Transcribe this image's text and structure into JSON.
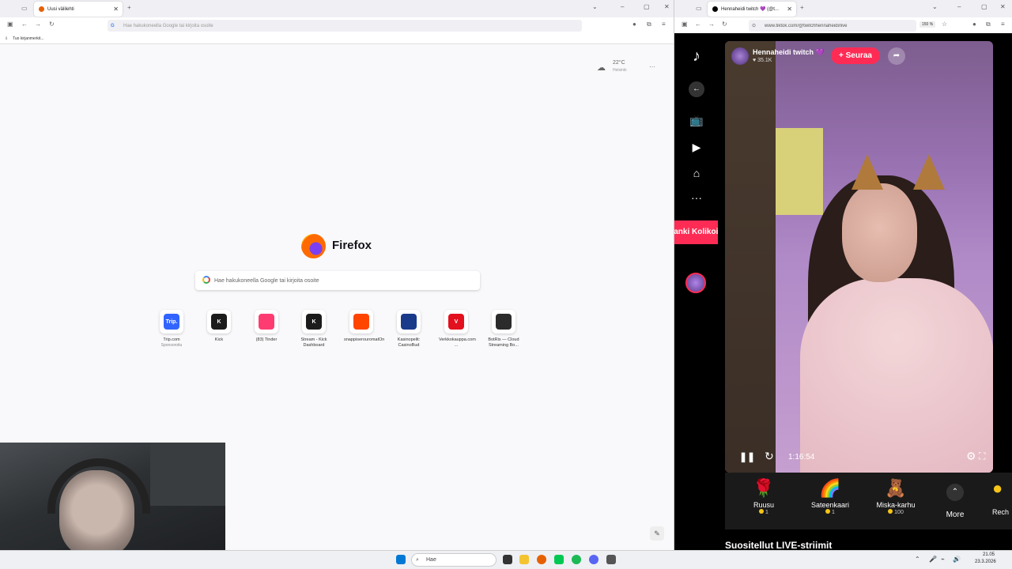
{
  "left_browser": {
    "tab_title": "Uusi välilehti",
    "url_placeholder": "Hae hakukoneella Google tai kirjoita osoite",
    "bookmarks_import": "Tuo kirjanmerkit...",
    "weather": {
      "temp": "22°C",
      "location": "Helsinki"
    },
    "brand": "Firefox",
    "search_placeholder": "Hae hakukoneella Google tai kirjoita osoite",
    "shortcuts": [
      {
        "label": "Trip.com",
        "sub": "Sponsoroitu",
        "icon_text": "Trip.",
        "color": "#3264ff"
      },
      {
        "label": "Kick",
        "sub": "",
        "icon_text": "K",
        "color": "#1c1c1c"
      },
      {
        "label": "(83) Tinder",
        "sub": "",
        "icon_text": "",
        "color": "#fe3c72"
      },
      {
        "label": "Stream - Kick Dashboard",
        "sub": "",
        "icon_text": "K",
        "color": "#1c1c1c"
      },
      {
        "label": "snappiserouromatOn",
        "sub": "",
        "icon_text": "",
        "color": "#ff4500"
      },
      {
        "label": "Kasinopelit: CasinoBud",
        "sub": "",
        "icon_text": "",
        "color": "#1a3a8a"
      },
      {
        "label": "Verkkokauppa.com ...",
        "sub": "",
        "icon_text": "V",
        "color": "#e3101e"
      },
      {
        "label": "BotRix — Cloud Streaming Bo...",
        "sub": "",
        "icon_text": "",
        "color": "#2b2b2b"
      }
    ]
  },
  "right_browser": {
    "tab_title": "Hennaheidi twitch 💜 (@t...",
    "url": "www.tiktok.com/@twitchhennaheidi/live",
    "zoom": "150 %",
    "gift_banner": "Hanki Kolikoita",
    "streamer": {
      "name": "Hennaheidi twitch 💜",
      "likes": "35.1K"
    },
    "follow_label": "+ Seuraa",
    "elapsed": "1:16:54",
    "gifts": [
      {
        "name": "Ruusu",
        "price": "1",
        "icon": "🌹"
      },
      {
        "name": "Sateenkaari",
        "price": "1",
        "icon": "🌈"
      },
      {
        "name": "Miska-karhu",
        "price": "100",
        "icon": "🧸"
      }
    ],
    "more_label": "More",
    "recharge_label": "Rech",
    "recommended": "Suositellut LIVE-striimit"
  },
  "taskbar": {
    "search_placeholder": "Hae",
    "time": "21.05",
    "date": "23.3.2026"
  }
}
